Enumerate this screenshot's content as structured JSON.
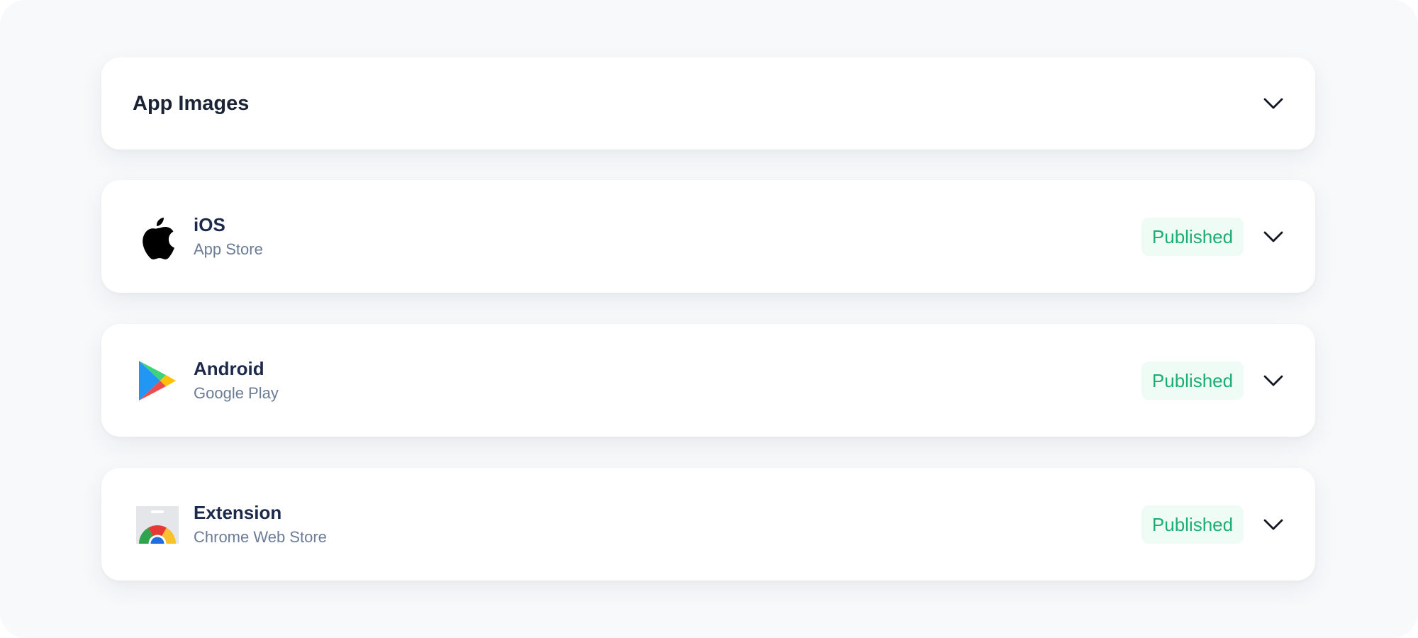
{
  "section": {
    "title": "App Images"
  },
  "platforms": [
    {
      "name": "iOS",
      "store": "App Store",
      "status": "Published",
      "icon": "apple-icon"
    },
    {
      "name": "Android",
      "store": "Google Play",
      "status": "Published",
      "icon": "google-play-icon"
    },
    {
      "name": "Extension",
      "store": "Chrome Web Store",
      "status": "Published",
      "icon": "chrome-web-store-icon"
    }
  ],
  "colors": {
    "page_bg": "#f8f9fb",
    "card_bg": "#ffffff",
    "title_text": "#1b2a4a",
    "subtitle_text": "#6b7c94",
    "badge_bg": "#effbf5",
    "badge_text": "#1dac74"
  }
}
